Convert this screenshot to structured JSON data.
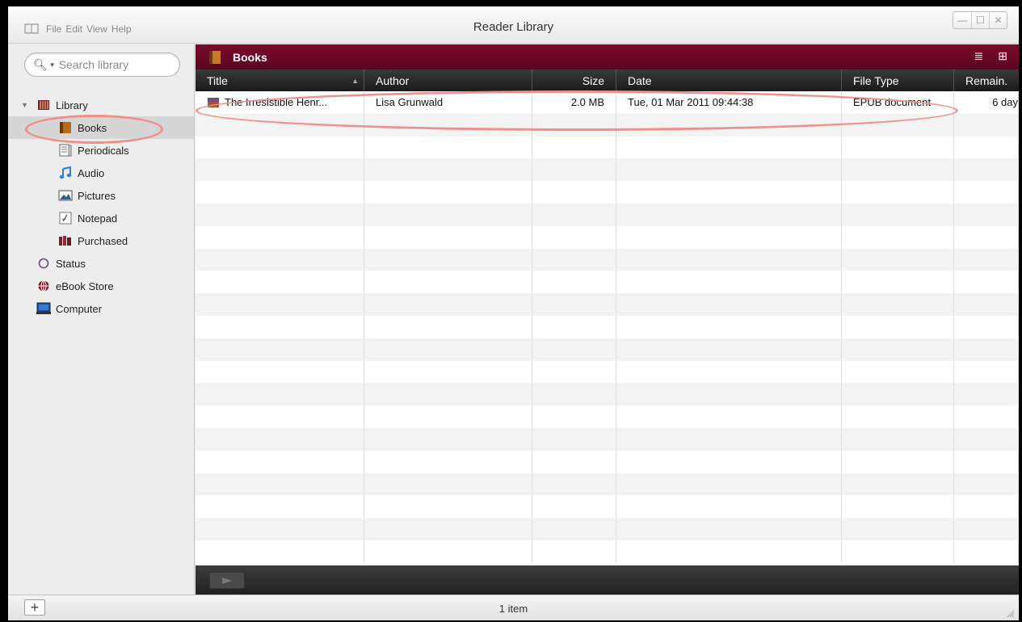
{
  "window": {
    "title": "Reader Library",
    "menu": [
      "File",
      "Edit",
      "View",
      "Help"
    ],
    "controls": {
      "minimize": "—",
      "maximize": "☐",
      "close": "✕"
    }
  },
  "search": {
    "placeholder": "Search library"
  },
  "sidebar": {
    "items": [
      {
        "label": "Library",
        "icon": "library-icon"
      },
      {
        "label": "Books",
        "icon": "books-icon"
      },
      {
        "label": "Periodicals",
        "icon": "periodicals-icon"
      },
      {
        "label": "Audio",
        "icon": "audio-icon"
      },
      {
        "label": "Pictures",
        "icon": "pictures-icon"
      },
      {
        "label": "Notepad",
        "icon": "notepad-icon"
      },
      {
        "label": "Purchased",
        "icon": "purchased-icon"
      },
      {
        "label": "Status",
        "icon": "status-icon"
      },
      {
        "label": "eBook Store",
        "icon": "globe-icon"
      },
      {
        "label": "Computer",
        "icon": "computer-icon"
      }
    ]
  },
  "main": {
    "header_title": "Books",
    "columns": {
      "title": "Title",
      "author": "Author",
      "size": "Size",
      "date": "Date",
      "type": "File Type",
      "remain": "Remain."
    },
    "books": [
      {
        "title": "The Irresistible Henr...",
        "author": "Lisa Grunwald",
        "size": "2.0 MB",
        "date": "Tue, 01 Mar 2011 09:44:38",
        "type": "EPUB document",
        "remain": "6 day"
      }
    ]
  },
  "status": {
    "count": "1 item"
  },
  "colors": {
    "accent": "#6e0826",
    "annotation": "#f0908c",
    "selected": "#d6d6d6"
  }
}
